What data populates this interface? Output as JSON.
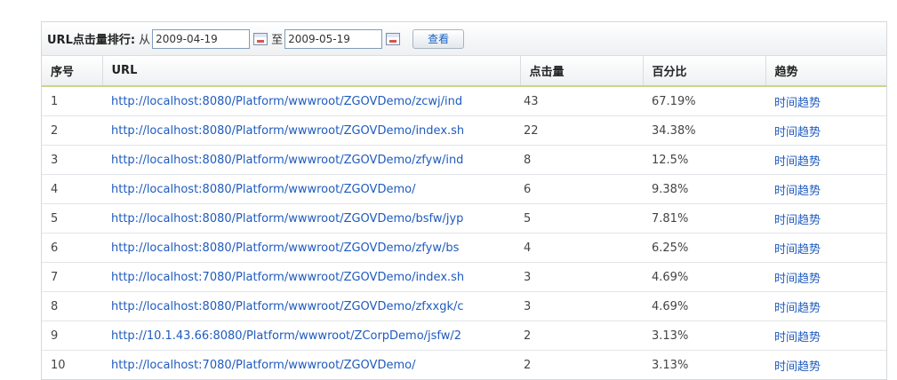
{
  "toolbar": {
    "title": "URL点击量排行:",
    "from_label": "从",
    "start_date": "2009-04-19",
    "to_label": "至",
    "end_date": "2009-05-19",
    "view_button": "查看"
  },
  "table": {
    "headers": [
      "序号",
      "URL",
      "点击量",
      "百分比",
      "趋势"
    ],
    "rows": [
      {
        "no": "1",
        "url": "http://localhost:8080/Platform/wwwroot/ZGOVDemo/zcwj/ind",
        "clicks": "43",
        "percent": "67.19%",
        "trend": "时间趋势"
      },
      {
        "no": "2",
        "url": "http://localhost:8080/Platform/wwwroot/ZGOVDemo/index.sh",
        "clicks": "22",
        "percent": "34.38%",
        "trend": "时间趋势"
      },
      {
        "no": "3",
        "url": "http://localhost:8080/Platform/wwwroot/ZGOVDemo/zfyw/ind",
        "clicks": "8",
        "percent": "12.5%",
        "trend": "时间趋势"
      },
      {
        "no": "4",
        "url": "http://localhost:8080/Platform/wwwroot/ZGOVDemo/",
        "clicks": "6",
        "percent": "9.38%",
        "trend": "时间趋势"
      },
      {
        "no": "5",
        "url": "http://localhost:8080/Platform/wwwroot/ZGOVDemo/bsfw/jyp",
        "clicks": "5",
        "percent": "7.81%",
        "trend": "时间趋势"
      },
      {
        "no": "6",
        "url": "http://localhost:8080/Platform/wwwroot/ZGOVDemo/zfyw/bs",
        "clicks": "4",
        "percent": "6.25%",
        "trend": "时间趋势"
      },
      {
        "no": "7",
        "url": "http://localhost:7080/Platform/wwwroot/ZGOVDemo/index.sh",
        "clicks": "3",
        "percent": "4.69%",
        "trend": "时间趋势"
      },
      {
        "no": "8",
        "url": "http://localhost:8080/Platform/wwwroot/ZGOVDemo/zfxxgk/c",
        "clicks": "3",
        "percent": "4.69%",
        "trend": "时间趋势"
      },
      {
        "no": "9",
        "url": "http://10.1.43.66:8080/Platform/wwwroot/ZCorpDemo/jsfw/2",
        "clicks": "2",
        "percent": "3.13%",
        "trend": "时间趋势"
      },
      {
        "no": "10",
        "url": "http://localhost:7080/Platform/wwwroot/ZGOVDemo/",
        "clicks": "2",
        "percent": "3.13%",
        "trend": "时间趋势"
      }
    ]
  },
  "colors": {
    "link": "#1f5bbf",
    "header_rule": "#c8d68a"
  }
}
